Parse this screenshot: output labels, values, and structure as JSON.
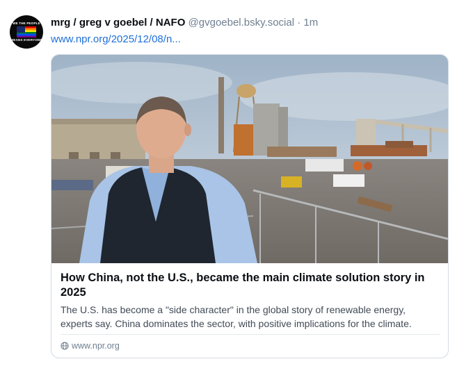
{
  "post": {
    "avatar_text_top": "WE THE PEOPLE",
    "avatar_text_bottom": "MEANS EVERYONE",
    "display_name": "mrg / greg v goebel / NAFO",
    "handle": "@gvgoebel.bsky.social",
    "separator": "·",
    "time": "1m",
    "link_text": "www.npr.org/2025/12/08/n..."
  },
  "card": {
    "title": "How China, not the U.S., became the main climate solution story in 2025",
    "description": "The U.S. has become a \"side character\" in the global story of renewable energy, experts say. China dominates the sector, with positive implications for the climate.",
    "source": "www.npr.org",
    "source_icon": "globe-icon"
  },
  "colors": {
    "link": "#1f6fd8",
    "muted": "#6f7f91",
    "border": "#d4dbe2"
  }
}
